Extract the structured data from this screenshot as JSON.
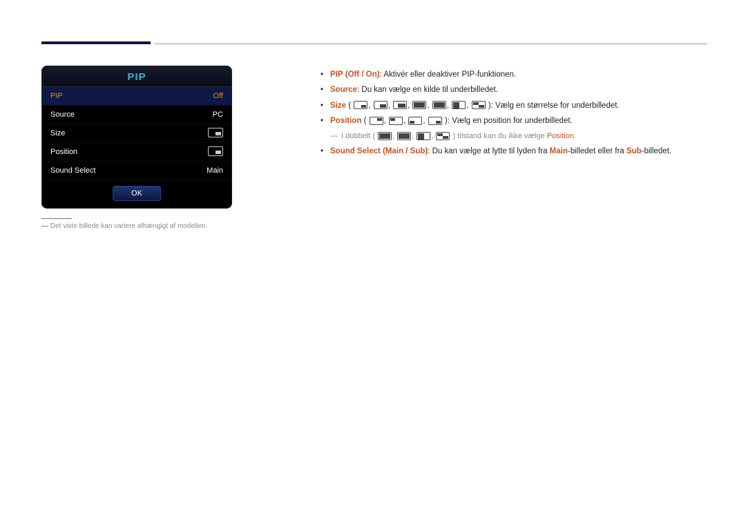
{
  "menu": {
    "title": "PIP",
    "rows": {
      "pip": {
        "label": "PIP",
        "value": "Off"
      },
      "source": {
        "label": "Source",
        "value": "PC"
      },
      "size": {
        "label": "Size"
      },
      "position": {
        "label": "Position"
      },
      "sound": {
        "label": "Sound Select",
        "value": "Main"
      }
    },
    "ok": "OK"
  },
  "footnote": "Det viste billede kan variere afhængigt af modellen.",
  "desc": {
    "pip": {
      "term": "PIP",
      "opts": "Off / On",
      "text": ": Aktivér eller deaktiver PIP-funktionen."
    },
    "source": {
      "term": "Source",
      "text": ": Du kan vælge en kilde til underbilledet."
    },
    "size": {
      "term": "Size",
      "text": ": Vælg en størrelse for underbilledet."
    },
    "position": {
      "term": "Position",
      "text": ": Vælg en position for underbilledet."
    },
    "note_pre": "I dobbelt (",
    "note_post": ") tilstand kan du ikke vælge ",
    "note_term": "Position",
    "note_end": ".",
    "sound": {
      "term": "Sound Select",
      "opts": "Main / Sub",
      "pre": ": Du kan vælge at lytte til lyden fra ",
      "main": "Main",
      "mid": "-billedet eller fra ",
      "sub": "Sub",
      "end": "-billedet."
    }
  }
}
